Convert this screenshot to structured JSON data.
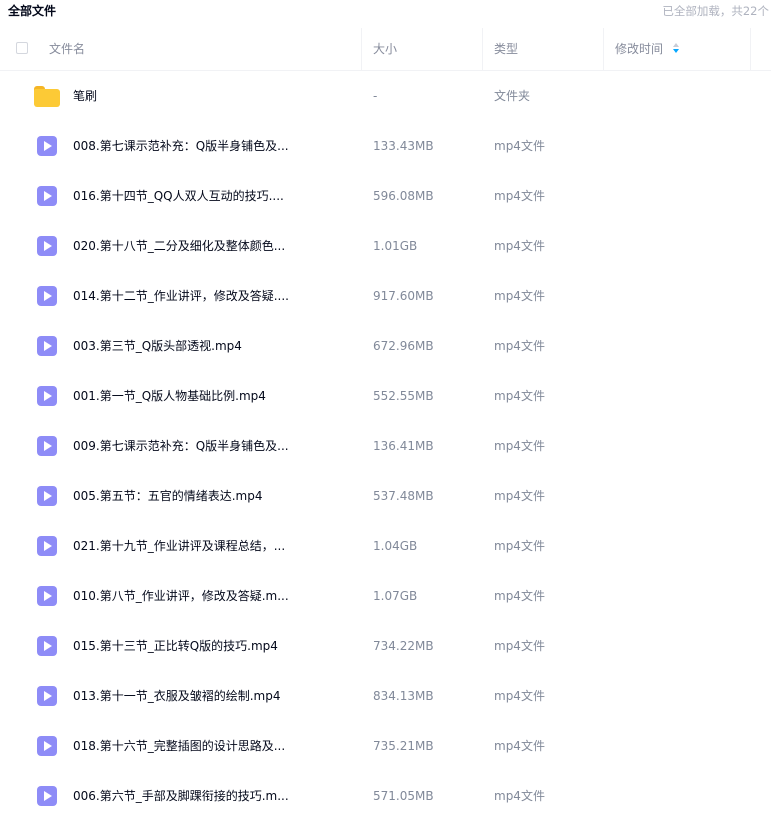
{
  "header_bar": {
    "title": "全部文件",
    "status": "已全部加载，共22个"
  },
  "table": {
    "columns": {
      "name": "文件名",
      "size": "大小",
      "type": "类型",
      "modified": "修改时间"
    },
    "sort_icon": "sort-descending-icon",
    "rows": [
      {
        "icon": "folder-icon",
        "name": "笔刷",
        "size": "-",
        "type": "文件夹"
      },
      {
        "icon": "video-file-icon",
        "name": "008.第七课示范补充：Q版半身铺色及...",
        "size": "133.43MB",
        "type": "mp4文件"
      },
      {
        "icon": "video-file-icon",
        "name": "016.第十四节_QQ人双人互动的技巧....",
        "size": "596.08MB",
        "type": "mp4文件"
      },
      {
        "icon": "video-file-icon",
        "name": "020.第十八节_二分及细化及整体颜色...",
        "size": "1.01GB",
        "type": "mp4文件"
      },
      {
        "icon": "video-file-icon",
        "name": "014.第十二节_作业讲评，修改及答疑....",
        "size": "917.60MB",
        "type": "mp4文件"
      },
      {
        "icon": "video-file-icon",
        "name": "003.第三节_Q版头部透视.mp4",
        "size": "672.96MB",
        "type": "mp4文件"
      },
      {
        "icon": "video-file-icon",
        "name": "001.第一节_Q版人物基础比例.mp4",
        "size": "552.55MB",
        "type": "mp4文件"
      },
      {
        "icon": "video-file-icon",
        "name": "009.第七课示范补充：Q版半身铺色及...",
        "size": "136.41MB",
        "type": "mp4文件"
      },
      {
        "icon": "video-file-icon",
        "name": "005.第五节：五官的情绪表达.mp4",
        "size": "537.48MB",
        "type": "mp4文件"
      },
      {
        "icon": "video-file-icon",
        "name": "021.第十九节_作业讲评及课程总结，...",
        "size": "1.04GB",
        "type": "mp4文件"
      },
      {
        "icon": "video-file-icon",
        "name": "010.第八节_作业讲评，修改及答疑.m...",
        "size": "1.07GB",
        "type": "mp4文件"
      },
      {
        "icon": "video-file-icon",
        "name": "015.第十三节_正比转Q版的技巧.mp4",
        "size": "734.22MB",
        "type": "mp4文件"
      },
      {
        "icon": "video-file-icon",
        "name": "013.第十一节_衣服及皱褶的绘制.mp4",
        "size": "834.13MB",
        "type": "mp4文件"
      },
      {
        "icon": "video-file-icon",
        "name": "018.第十六节_完整插图的设计思路及...",
        "size": "735.21MB",
        "type": "mp4文件"
      },
      {
        "icon": "video-file-icon",
        "name": "006.第六节_手部及脚踝衔接的技巧.m...",
        "size": "571.05MB",
        "type": "mp4文件"
      }
    ]
  },
  "colors": {
    "accent": "#06a7ff",
    "video_icon": "#8e8cf7",
    "folder_icon": "#fcca36",
    "muted_text": "#818999"
  }
}
